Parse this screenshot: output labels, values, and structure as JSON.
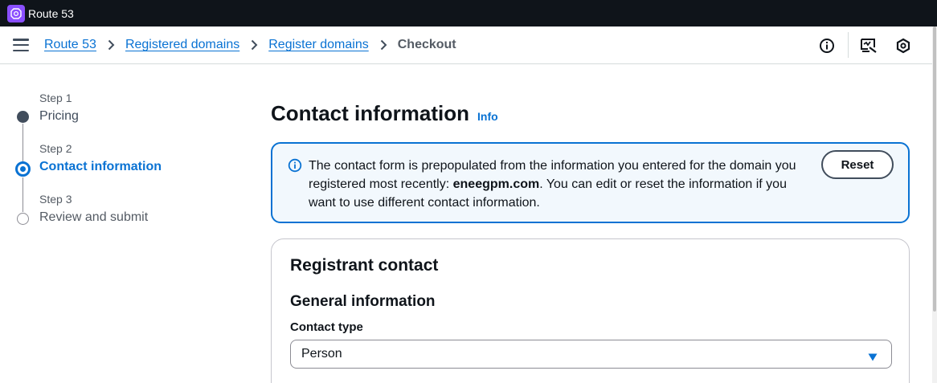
{
  "topbar": {
    "service_name": "Route 53"
  },
  "breadcrumbs": {
    "items": [
      "Route 53",
      "Registered domains",
      "Register domains"
    ],
    "current": "Checkout"
  },
  "steps": [
    {
      "label": "Step 1",
      "title": "Pricing",
      "state": "completed"
    },
    {
      "label": "Step 2",
      "title": "Contact information",
      "state": "active"
    },
    {
      "label": "Step 3",
      "title": "Review and submit",
      "state": "pending"
    }
  ],
  "page": {
    "title": "Contact information",
    "info_link": "Info"
  },
  "alert": {
    "text_before": "The contact form is prepopulated from the information you entered for the domain you registered most recently: ",
    "domain": "eneegpm.com",
    "text_after": ". You can edit or reset the information if you want to use different contact information.",
    "reset_label": "Reset"
  },
  "registrant": {
    "title": "Registrant contact",
    "section": "General information",
    "contact_type_label": "Contact type",
    "contact_type_value": "Person"
  },
  "colors": {
    "accent": "#0972d3",
    "topbar_bg": "#0f141a",
    "service_icon": "#8a4fff",
    "alert_bg": "#f2f8fd"
  },
  "icons": {
    "service": "route53-icon",
    "menu": "hamburger-menu-icon",
    "crumb_separator": "chevron-right-icon",
    "info": "info-circle-icon",
    "feedback": "feedback-icon",
    "settings": "hexagon-settings-icon",
    "select": "caret-down-icon"
  }
}
